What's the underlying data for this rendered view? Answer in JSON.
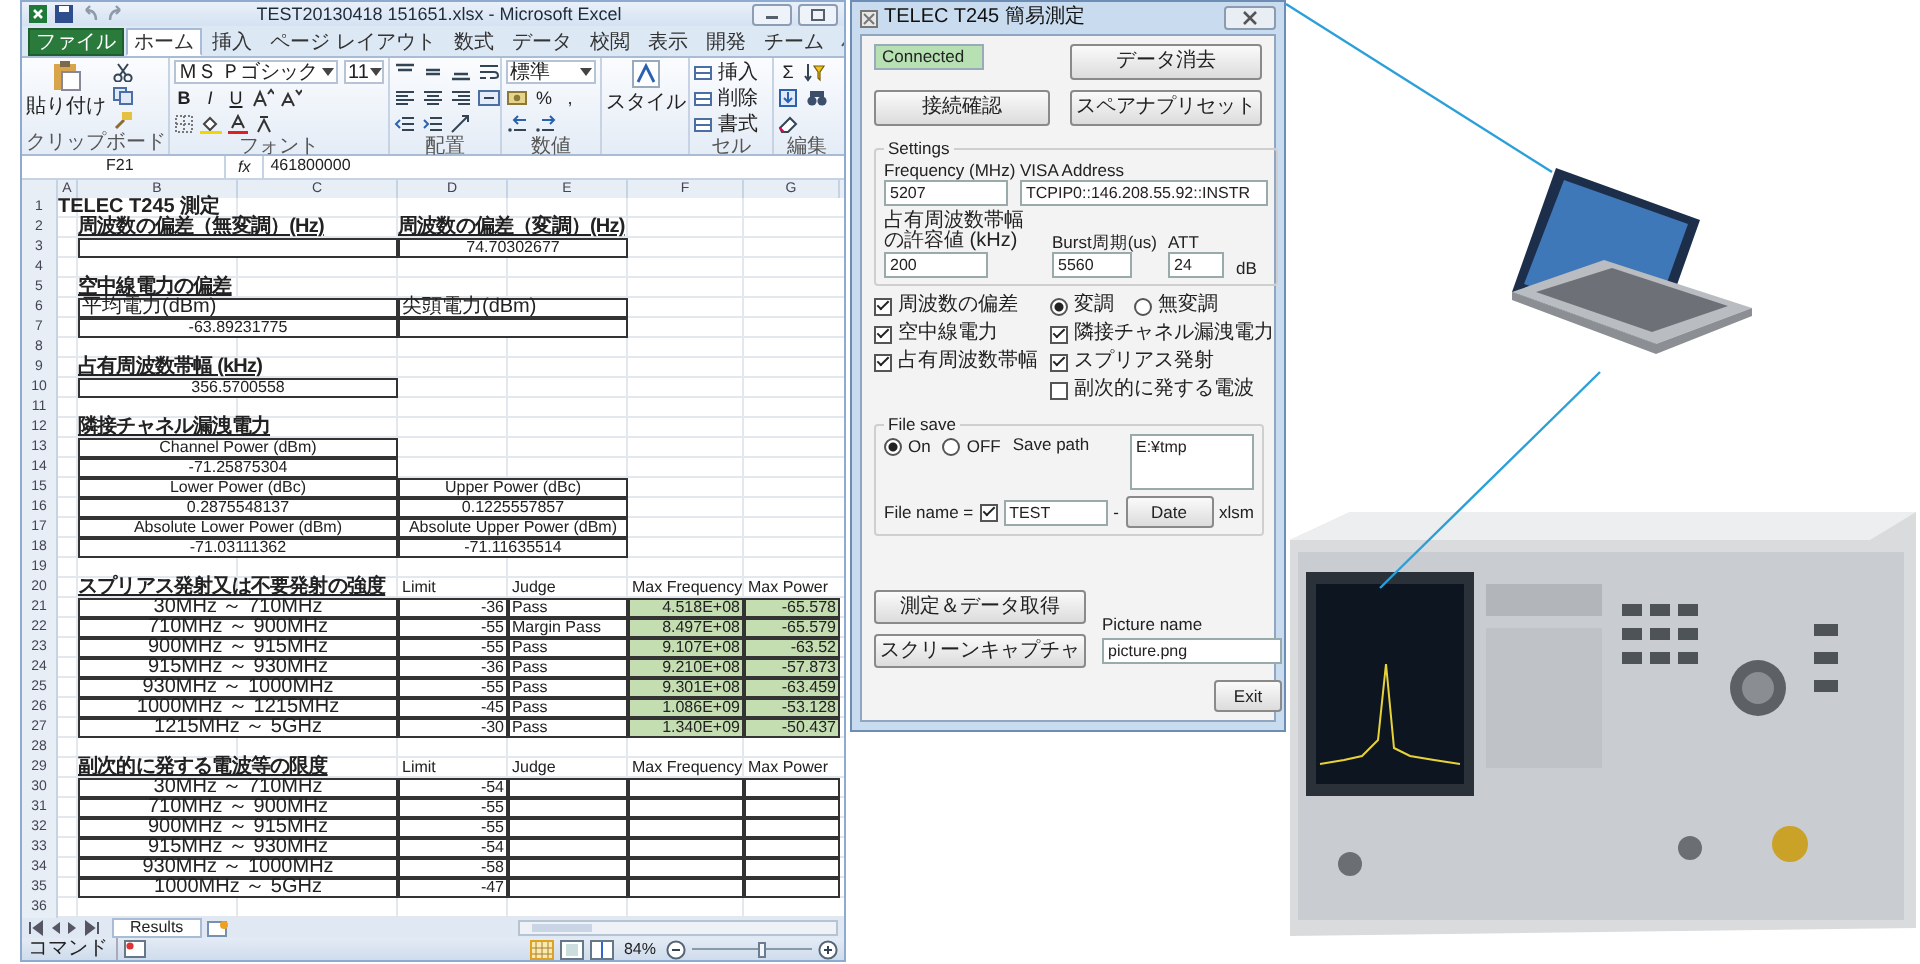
{
  "excel": {
    "title": "TEST20130418 151651.xlsx - Microsoft Excel",
    "tabs": [
      {
        "label": "ファイル",
        "kind": "file",
        "selected": false
      },
      {
        "label": "ホーム",
        "kind": "tab",
        "selected": true
      },
      {
        "label": "挿入",
        "kind": "tab",
        "selected": false
      },
      {
        "label": "ページ レイアウト",
        "kind": "tab",
        "selected": false
      },
      {
        "label": "数式",
        "kind": "tab",
        "selected": false
      },
      {
        "label": "データ",
        "kind": "tab",
        "selected": false
      },
      {
        "label": "校閲",
        "kind": "tab",
        "selected": false
      },
      {
        "label": "表示",
        "kind": "tab",
        "selected": false
      },
      {
        "label": "開発",
        "kind": "tab",
        "selected": false
      },
      {
        "label": "チーム",
        "kind": "tab",
        "selected": false
      }
    ],
    "ribbon": {
      "groups": [
        {
          "kind": "clipboard",
          "label": "クリップボード",
          "buttons": [
            "貼り付け"
          ]
        },
        {
          "kind": "font",
          "label": "フォント",
          "font_name": "ＭＳ Ｐゴシック",
          "font_size": "11",
          "buttons": [
            "B",
            "I",
            "U"
          ]
        },
        {
          "kind": "alignment",
          "label": "配置"
        },
        {
          "kind": "number",
          "label": "数値",
          "format": "標準",
          "buttons": [
            "%",
            ","
          ]
        },
        {
          "kind": "styles",
          "buttons": [
            "スタイル"
          ]
        },
        {
          "kind": "cells",
          "label": "セル",
          "buttons": [
            "挿入",
            "削除",
            "書式"
          ]
        },
        {
          "kind": "editing",
          "label": "編集",
          "buttons": [
            "Σ"
          ]
        }
      ]
    },
    "name_box": "F21",
    "function_label": "fx",
    "formula": "461800000",
    "columns": [
      "A",
      "B",
      "C",
      "D",
      "E",
      "F",
      "G"
    ],
    "rows": [
      {
        "n": "1",
        "kind": "title",
        "cells": [
          "TELEC T245 測定",
          "",
          "",
          "",
          "",
          "",
          ""
        ]
      },
      {
        "n": "2",
        "kind": "headings",
        "cells": [
          "",
          "周波数の偏差（無変調）(Hz)",
          "",
          "周波数の偏差（変調）(Hz)",
          "",
          "",
          ""
        ]
      },
      {
        "n": "3",
        "kind": "value-pair",
        "cells": [
          "",
          "",
          "",
          "74.70302677",
          "",
          "",
          ""
        ]
      },
      {
        "n": "4",
        "kind": "empty",
        "cells": []
      },
      {
        "n": "5",
        "kind": "heading",
        "cells": [
          "",
          "空中線電力の偏差",
          "",
          "",
          "",
          "",
          ""
        ]
      },
      {
        "n": "6",
        "kind": "field-pair",
        "cells": [
          "",
          "平均電力(dBm)",
          "",
          "尖頭電力(dBm)",
          "",
          "",
          ""
        ]
      },
      {
        "n": "7",
        "kind": "value-pair",
        "cells": [
          "",
          "-63.89231775",
          "",
          "",
          "",
          "",
          ""
        ]
      },
      {
        "n": "8",
        "kind": "empty",
        "cells": []
      },
      {
        "n": "9",
        "kind": "heading",
        "cells": [
          "",
          "占有周波数帯幅 (kHz)",
          "",
          "",
          "",
          "",
          ""
        ]
      },
      {
        "n": "10",
        "kind": "value",
        "cells": [
          "",
          "356.5700558",
          "",
          "",
          "",
          "",
          ""
        ]
      },
      {
        "n": "11",
        "kind": "empty",
        "cells": []
      },
      {
        "n": "12",
        "kind": "heading",
        "cells": [
          "",
          "隣接チャネル漏洩電力",
          "",
          "",
          "",
          "",
          ""
        ]
      },
      {
        "n": "13",
        "kind": "value",
        "cells": [
          "",
          "Channel Power (dBm)",
          "",
          "",
          "",
          "",
          ""
        ]
      },
      {
        "n": "14",
        "kind": "value",
        "cells": [
          "",
          "-71.25875304",
          "",
          "",
          "",
          "",
          ""
        ]
      },
      {
        "n": "15",
        "kind": "value-pair",
        "cells": [
          "",
          "Lower Power (dBc)",
          "",
          "Upper Power (dBc)",
          "",
          "",
          ""
        ]
      },
      {
        "n": "16",
        "kind": "value-pair",
        "cells": [
          "",
          "0.2875548137",
          "",
          "0.1225557857",
          "",
          "",
          ""
        ]
      },
      {
        "n": "17",
        "kind": "value-pair",
        "cells": [
          "",
          "Absolute Lower Power (dBm)",
          "",
          "Absolute Upper Power (dBm)",
          "",
          "",
          ""
        ]
      },
      {
        "n": "18",
        "kind": "value-pair",
        "cells": [
          "",
          "-71.03111362",
          "",
          "-71.11635514",
          "",
          "",
          ""
        ]
      },
      {
        "n": "19",
        "kind": "empty",
        "cells": []
      },
      {
        "n": "20",
        "kind": "section",
        "cells": [
          "",
          "スプリアス発射又は不要発射の強度",
          "",
          "Limit",
          "Judge",
          "Max Frequency",
          "Max Power"
        ]
      },
      {
        "n": "21",
        "kind": "result",
        "cells": [
          "",
          "30MHz ～ 710MHz",
          "",
          "-36",
          "Pass",
          "4.518E+08",
          "-65.578"
        ]
      },
      {
        "n": "22",
        "kind": "result",
        "cells": [
          "",
          "710MHz ～ 900MHz",
          "",
          "-55",
          "Margin Pass",
          "8.497E+08",
          "-65.579"
        ]
      },
      {
        "n": "23",
        "kind": "result",
        "cells": [
          "",
          "900MHz ～ 915MHz",
          "",
          "-55",
          "Pass",
          "9.107E+08",
          "-63.52"
        ]
      },
      {
        "n": "24",
        "kind": "result",
        "cells": [
          "",
          "915MHz ～ 930MHz",
          "",
          "-36",
          "Pass",
          "9.210E+08",
          "-57.873"
        ]
      },
      {
        "n": "25",
        "kind": "result",
        "cells": [
          "",
          "930MHz ～ 1000MHz",
          "",
          "-55",
          "Pass",
          "9.301E+08",
          "-63.459"
        ]
      },
      {
        "n": "26",
        "kind": "result",
        "cells": [
          "",
          "1000MHz ～ 1215MHz",
          "",
          "-45",
          "Pass",
          "1.086E+09",
          "-53.128"
        ]
      },
      {
        "n": "27",
        "kind": "result",
        "cells": [
          "",
          "1215MHz ～ 5GHz",
          "",
          "-30",
          "Pass",
          "1.340E+09",
          "-50.437"
        ]
      },
      {
        "n": "28",
        "kind": "empty",
        "cells": []
      },
      {
        "n": "29",
        "kind": "section",
        "cells": [
          "",
          "副次的に発する電波等の限度",
          "",
          "Limit",
          "Judge",
          "Max Frequency",
          "Max Power"
        ]
      },
      {
        "n": "30",
        "kind": "limit",
        "cells": [
          "",
          "30MHz ～ 710MHz",
          "",
          "-54",
          "",
          "",
          ""
        ]
      },
      {
        "n": "31",
        "kind": "limit",
        "cells": [
          "",
          "710MHz ～ 900MHz",
          "",
          "-55",
          "",
          "",
          ""
        ]
      },
      {
        "n": "32",
        "kind": "limit",
        "cells": [
          "",
          "900MHz ～ 915MHz",
          "",
          "-55",
          "",
          "",
          ""
        ]
      },
      {
        "n": "33",
        "kind": "limit",
        "cells": [
          "",
          "915MHz ～ 930MHz",
          "",
          "-54",
          "",
          "",
          ""
        ]
      },
      {
        "n": "34",
        "kind": "limit",
        "cells": [
          "",
          "930MHz ～ 1000MHz",
          "",
          "-58",
          "",
          "",
          ""
        ]
      },
      {
        "n": "35",
        "kind": "limit",
        "cells": [
          "",
          "1000MHz ～ 5GHz",
          "",
          "-47",
          "",
          "",
          ""
        ]
      },
      {
        "n": "36",
        "kind": "empty",
        "cells": []
      }
    ],
    "sheet_tabs": [
      {
        "label": "Results",
        "selected": true
      }
    ],
    "status": "コマンド",
    "zoom": "84%",
    "zoom_slider": {
      "level": 0.58
    }
  },
  "dialog": {
    "title": "TELEC T245 簡易測定",
    "status": "Connected",
    "buttons_top": [
      "データ消去",
      "接続確認",
      "スペアナプリセット"
    ],
    "settings": {
      "legend": "Settings",
      "frequency_label": "Frequency (MHz)",
      "frequency": "5207",
      "visa_label": "VISA Address",
      "visa": "TCPIP0::146.208.55.92::INSTR",
      "obw_label": "占有周波数帯幅の許容値 (kHz)",
      "obw": "200",
      "burst_label": "Burst周期(us)",
      "burst": "5560",
      "att_label": "ATT",
      "att": "24",
      "att_unit": "dB"
    },
    "checks_left": [
      {
        "label": "周波数の偏差",
        "checked": true
      },
      {
        "label": "空中線電力",
        "checked": true
      },
      {
        "label": "占有周波数帯幅",
        "checked": true
      }
    ],
    "modulation": [
      {
        "label": "変調",
        "selected": true
      },
      {
        "label": "無変調",
        "selected": false
      }
    ],
    "checks_right": [
      {
        "label": "隣接チャネル漏洩電力",
        "checked": true
      },
      {
        "label": "スプリアス発射",
        "checked": true
      },
      {
        "label": "副次的に発する電波",
        "checked": false
      }
    ],
    "file_save": {
      "legend": "File save",
      "modes": [
        {
          "label": "On",
          "selected": true
        },
        {
          "label": "OFF",
          "selected": false
        }
      ],
      "path_label": "Save path",
      "path": "E:¥tmp",
      "name_label": "File name =",
      "name_checked": true,
      "name": "TEST",
      "separator": "-",
      "date_button": "Date",
      "extension": "xlsm"
    },
    "action_buttons": [
      "測定＆データ取得",
      "スクリーンキャプチャ"
    ],
    "picture_label": "Picture name",
    "picture": "picture.png",
    "exit": "Exit"
  }
}
